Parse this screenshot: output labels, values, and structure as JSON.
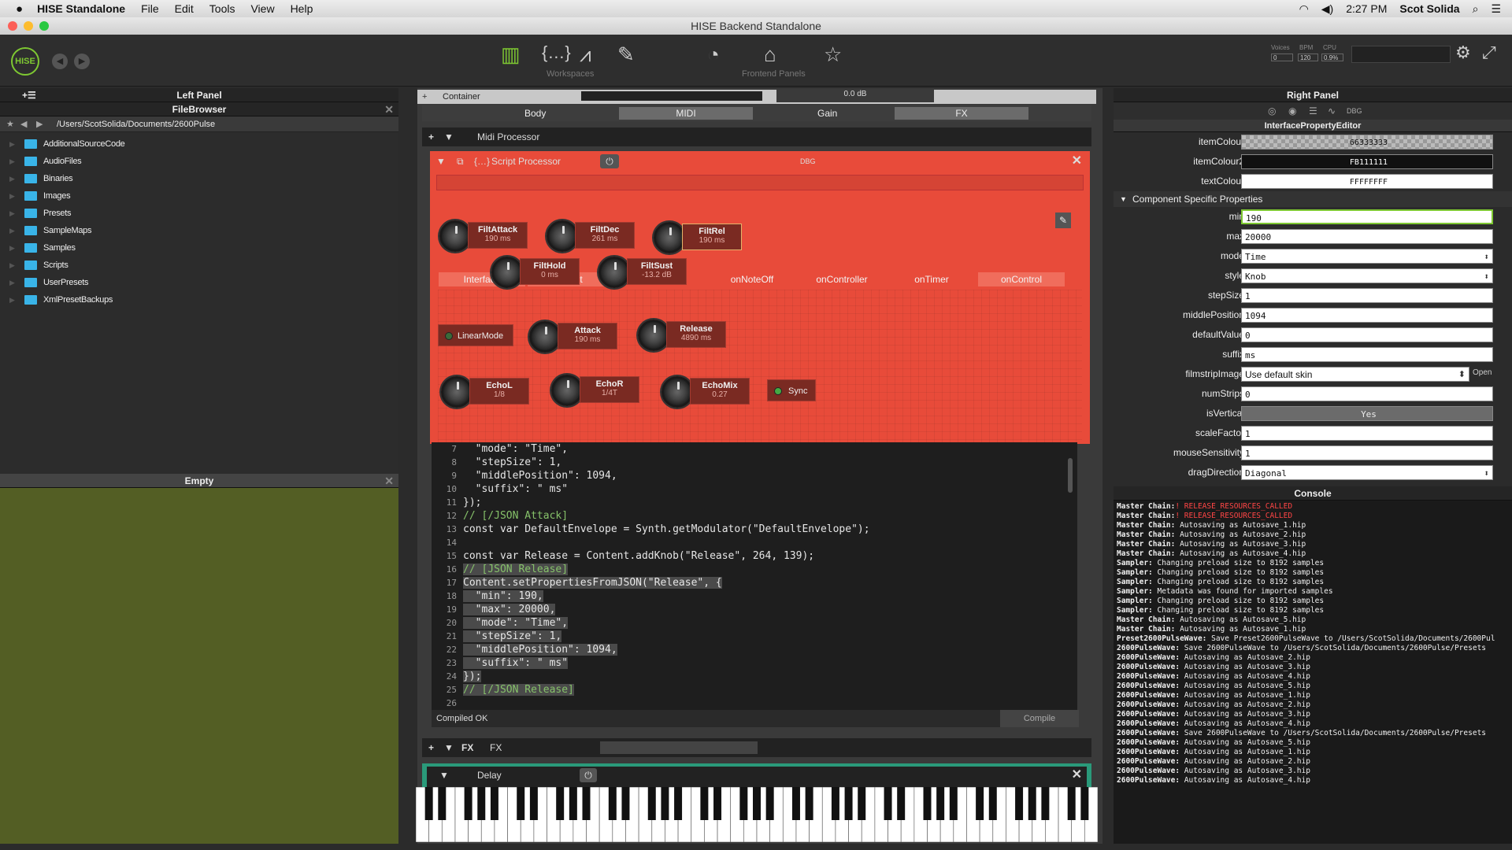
{
  "menubar": {
    "app_name": "HISE Standalone",
    "items": [
      "File",
      "Edit",
      "Tools",
      "View",
      "Help"
    ],
    "clock": "2:27 PM",
    "user": "Scot Solida"
  },
  "window_title": "HISE Backend Standalone",
  "toolbar": {
    "logo": "HISE",
    "workspaces_label": "Workspaces",
    "frontend_label": "Frontend Panels",
    "voices_label": "Voices",
    "voices": "0",
    "bpm_label": "BPM",
    "bpm": "120",
    "cpu_label": "CPU",
    "cpu": "0.9%"
  },
  "left": {
    "title": "Left Panel",
    "filebrowser_title": "FileBrowser",
    "path": "/Users/ScotSolida/Documents/2600Pulse",
    "folders": [
      "AdditionalSourceCode",
      "AudioFiles",
      "Binaries",
      "Images",
      "Presets",
      "SampleMaps",
      "Samples",
      "Scripts",
      "UserPresets",
      "XmlPresetBackups"
    ],
    "empty_title": "Empty"
  },
  "center": {
    "container_label": "Container",
    "gain_db": "0.0 dB",
    "tabs": [
      "Body",
      "MIDI",
      "Gain",
      "FX",
      "FX"
    ],
    "midi_processor_label": "Midi Processor",
    "script_title": "Script Processor",
    "dbg": "DBG",
    "script_tabs": [
      "Interface",
      "onInit",
      "onNoteOn",
      "onNoteOff",
      "onController",
      "onTimer",
      "onControl"
    ],
    "knobs": [
      {
        "name": "FiltAttack",
        "value": "190 ms"
      },
      {
        "name": "FiltDec",
        "value": "261 ms"
      },
      {
        "name": "FiltRel",
        "value": "190 ms"
      },
      {
        "name": "FiltHold",
        "value": "0 ms"
      },
      {
        "name": "FiltSust",
        "value": "-13.2 dB"
      },
      {
        "name": "Attack",
        "value": "190 ms"
      },
      {
        "name": "Release",
        "value": "4890 ms"
      },
      {
        "name": "EchoL",
        "value": "1/8"
      },
      {
        "name": "EchoR",
        "value": "1/4T"
      },
      {
        "name": "EchoMix",
        "value": "0.27"
      }
    ],
    "buttons": {
      "linear_mode": "LinearMode",
      "sync": "Sync"
    },
    "code_lines": [
      {
        "n": "7",
        "t": "  \"mode\": \"Time\","
      },
      {
        "n": "8",
        "t": "  \"stepSize\": 1,"
      },
      {
        "n": "9",
        "t": "  \"middlePosition\": 1094,"
      },
      {
        "n": "10",
        "t": "  \"suffix\": \" ms\""
      },
      {
        "n": "11",
        "t": "});"
      },
      {
        "n": "12",
        "t": "// [/JSON Attack]"
      },
      {
        "n": "13",
        "t": "const var DefaultEnvelope = Synth.getModulator(\"DefaultEnvelope\");"
      },
      {
        "n": "14",
        "t": ""
      },
      {
        "n": "15",
        "t": "const var Release = Content.addKnob(\"Release\", 264, 139);"
      },
      {
        "n": "16",
        "t": "// [JSON Release]"
      },
      {
        "n": "17",
        "t": "Content.setPropertiesFromJSON(\"Release\", {"
      },
      {
        "n": "18",
        "t": "  \"min\": 190,"
      },
      {
        "n": "19",
        "t": "  \"max\": 20000,"
      },
      {
        "n": "20",
        "t": "  \"mode\": \"Time\","
      },
      {
        "n": "21",
        "t": "  \"stepSize\": 1,"
      },
      {
        "n": "22",
        "t": "  \"middlePosition\": 1094,"
      },
      {
        "n": "23",
        "t": "  \"suffix\": \" ms\""
      },
      {
        "n": "24",
        "t": "});"
      },
      {
        "n": "25",
        "t": "// [/JSON Release]"
      },
      {
        "n": "26",
        "t": ""
      }
    ],
    "status": "Compiled OK",
    "compile_label": "Compile",
    "fx_label": "FX",
    "delay_label": "Delay"
  },
  "right": {
    "title": "Right Panel",
    "dbg": "DBG",
    "editor_title": "InterfacePropertyEditor",
    "colour_rows": [
      {
        "label": "itemColour",
        "value": "66333333"
      },
      {
        "label": "itemColour2",
        "value": "FB111111"
      },
      {
        "label": "textColour",
        "value": "FFFFFFFF"
      }
    ],
    "section_title": "Component Specific Properties",
    "props": [
      {
        "label": "min",
        "value": "190"
      },
      {
        "label": "max",
        "value": "20000"
      },
      {
        "label": "mode",
        "value": "Time"
      },
      {
        "label": "style",
        "value": "Knob"
      },
      {
        "label": "stepSize",
        "value": "1"
      },
      {
        "label": "middlePosition",
        "value": "1094"
      },
      {
        "label": "defaultValue",
        "value": "0"
      },
      {
        "label": "suffix",
        "value": "ms"
      },
      {
        "label": "filmstripImage",
        "value": "Use default skin"
      },
      {
        "label": "numStrips",
        "value": "0"
      },
      {
        "label": "isVertical",
        "value": "Yes"
      },
      {
        "label": "scaleFactor",
        "value": "1"
      },
      {
        "label": "mouseSensitivity",
        "value": "1"
      },
      {
        "label": "dragDirection",
        "value": "Diagonal"
      }
    ],
    "open_label": "Open",
    "console_title": "Console",
    "console_lines": [
      {
        "src": "Master Chain:",
        "msg": "! RELEASE_RESOURCES_CALLED",
        "err": true
      },
      {
        "src": "Master Chain:",
        "msg": "! RELEASE_RESOURCES_CALLED",
        "err": true
      },
      {
        "src": "Master Chain:",
        "msg": " Autosaving as Autosave_1.hip",
        "err": false
      },
      {
        "src": "Master Chain:",
        "msg": " Autosaving as Autosave_2.hip",
        "err": false
      },
      {
        "src": "Master Chain:",
        "msg": " Autosaving as Autosave_3.hip",
        "err": false
      },
      {
        "src": "Master Chain:",
        "msg": " Autosaving as Autosave_4.hip",
        "err": false
      },
      {
        "src": "Sampler:",
        "msg": " Changing preload size to 8192 samples",
        "err": false
      },
      {
        "src": "Sampler:",
        "msg": " Changing preload size to 8192 samples",
        "err": false
      },
      {
        "src": "Sampler:",
        "msg": " Changing preload size to 8192 samples",
        "err": false
      },
      {
        "src": "Sampler:",
        "msg": " Metadata was found for imported samples",
        "err": false
      },
      {
        "src": "Sampler:",
        "msg": " Changing preload size to 8192 samples",
        "err": false
      },
      {
        "src": "Sampler:",
        "msg": " Changing preload size to 8192 samples",
        "err": false
      },
      {
        "src": "Master Chain:",
        "msg": " Autosaving as Autosave_5.hip",
        "err": false
      },
      {
        "src": "Master Chain:",
        "msg": " Autosaving as Autosave_1.hip",
        "err": false
      },
      {
        "src": "Preset2600PulseWave:",
        "msg": " Save Preset2600PulseWave to /Users/ScotSolida/Documents/2600Pul",
        "err": false
      },
      {
        "src": "2600PulseWave:",
        "msg": " Save 2600PulseWave to /Users/ScotSolida/Documents/2600Pulse/Presets",
        "err": false
      },
      {
        "src": "2600PulseWave:",
        "msg": " Autosaving as Autosave_2.hip",
        "err": false
      },
      {
        "src": "2600PulseWave:",
        "msg": " Autosaving as Autosave_3.hip",
        "err": false
      },
      {
        "src": "2600PulseWave:",
        "msg": " Autosaving as Autosave_4.hip",
        "err": false
      },
      {
        "src": "2600PulseWave:",
        "msg": " Autosaving as Autosave_5.hip",
        "err": false
      },
      {
        "src": "2600PulseWave:",
        "msg": " Autosaving as Autosave_1.hip",
        "err": false
      },
      {
        "src": "2600PulseWave:",
        "msg": " Autosaving as Autosave_2.hip",
        "err": false
      },
      {
        "src": "2600PulseWave:",
        "msg": " Autosaving as Autosave_3.hip",
        "err": false
      },
      {
        "src": "2600PulseWave:",
        "msg": " Autosaving as Autosave_4.hip",
        "err": false
      },
      {
        "src": "2600PulseWave:",
        "msg": " Save 2600PulseWave to /Users/ScotSolida/Documents/2600Pulse/Presets",
        "err": false
      },
      {
        "src": "2600PulseWave:",
        "msg": " Autosaving as Autosave_5.hip",
        "err": false
      },
      {
        "src": "2600PulseWave:",
        "msg": " Autosaving as Autosave_1.hip",
        "err": false
      },
      {
        "src": "2600PulseWave:",
        "msg": " Autosaving as Autosave_2.hip",
        "err": false
      },
      {
        "src": "2600PulseWave:",
        "msg": " Autosaving as Autosave_3.hip",
        "err": false
      },
      {
        "src": "2600PulseWave:",
        "msg": " Autosaving as Autosave_4.hip",
        "err": false
      }
    ]
  },
  "colors": {
    "accent_red": "#e84b3a",
    "plus_green": "#7ec832",
    "folder_blue": "#39b4e8",
    "olive": "#535e24"
  },
  "icons": [
    "apple-icon",
    "hise-logo-icon",
    "back-icon",
    "forward-icon",
    "mixer-icon",
    "script-icon",
    "waveform-icon",
    "tools-icon",
    "meter-icon",
    "home-icon",
    "star-icon",
    "settings-icon",
    "fullscreen-icon",
    "folder-icon",
    "power-icon",
    "close-icon",
    "edit-icon",
    "keyboard-icon"
  ]
}
